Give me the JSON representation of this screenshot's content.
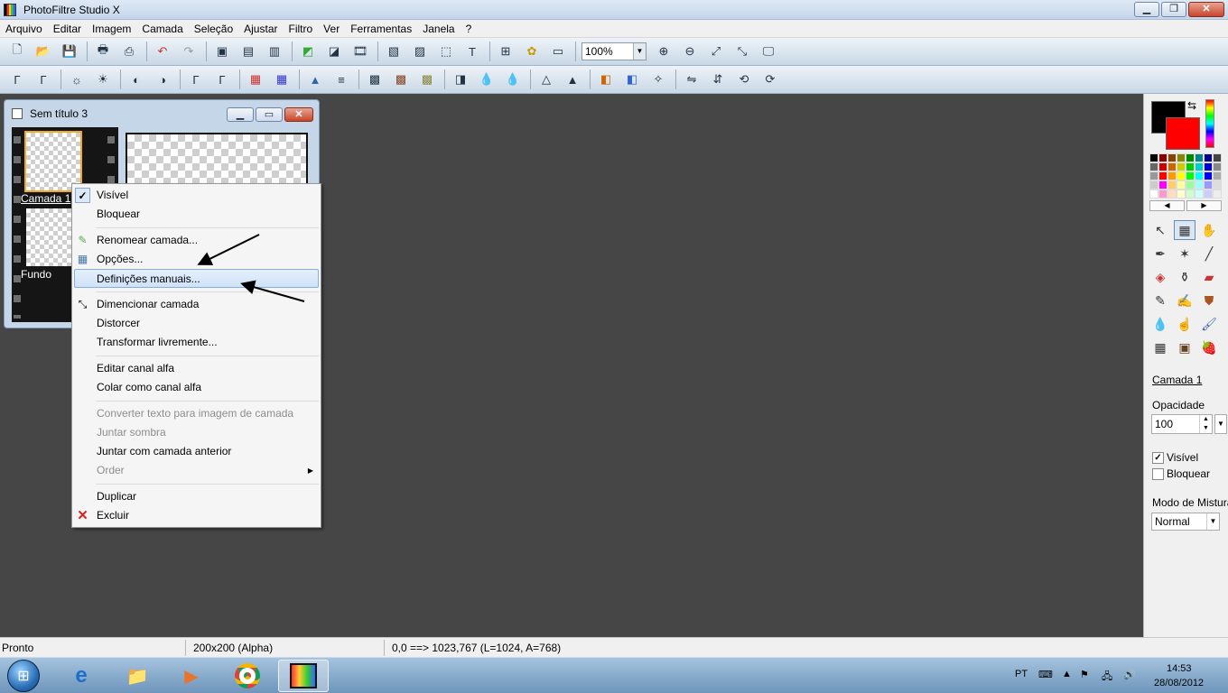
{
  "app": {
    "title": "PhotoFiltre Studio X"
  },
  "menu": [
    "Arquivo",
    "Editar",
    "Imagem",
    "Camada",
    "Seleção",
    "Ajustar",
    "Filtro",
    "Ver",
    "Ferramentas",
    "Janela",
    "?"
  ],
  "toolbar": {
    "zoom_value": "100%"
  },
  "document": {
    "title": "Sem título 3",
    "layers": [
      {
        "label": "Camada 1"
      },
      {
        "label": "Fundo"
      }
    ]
  },
  "context_menu": {
    "items": [
      {
        "label": "Visível",
        "checked": true
      },
      {
        "label": "Bloquear"
      },
      {
        "label": "Renomear camada..."
      },
      {
        "label": "Opções..."
      },
      {
        "label": "Definições manuais...",
        "highlighted": true
      },
      {
        "label": "Dimencionar camada"
      },
      {
        "label": "Distorcer"
      },
      {
        "label": "Transformar livremente..."
      },
      {
        "label": "Editar canal alfa"
      },
      {
        "label": "Colar como canal alfa"
      },
      {
        "label": "Converter texto para imagem de camada",
        "disabled": true
      },
      {
        "label": "Juntar sombra",
        "disabled": true
      },
      {
        "label": "Juntar com camada anterior"
      },
      {
        "label": "Order",
        "disabled": true,
        "submenu": true
      },
      {
        "label": "Duplicar"
      },
      {
        "label": "Excluir"
      }
    ]
  },
  "right_panel": {
    "foreground_color": "#000000",
    "background_color": "#ff0000",
    "layer_name": "Camada 1",
    "opacity_label": "Opacidade",
    "opacity_value": "100",
    "visible_label": "Visível",
    "visible_checked": true,
    "lock_label": "Bloquear",
    "lock_checked": false,
    "blend_label": "Modo de Mistura",
    "blend_value": "Normal"
  },
  "status": {
    "state": "Pronto",
    "size": "200x200 (Alpha)",
    "coords": "0,0 ==> 1023,767 (L=1024, A=768)"
  },
  "taskbar": {
    "lang": "PT",
    "time": "14:53",
    "date": "28/08/2012"
  }
}
